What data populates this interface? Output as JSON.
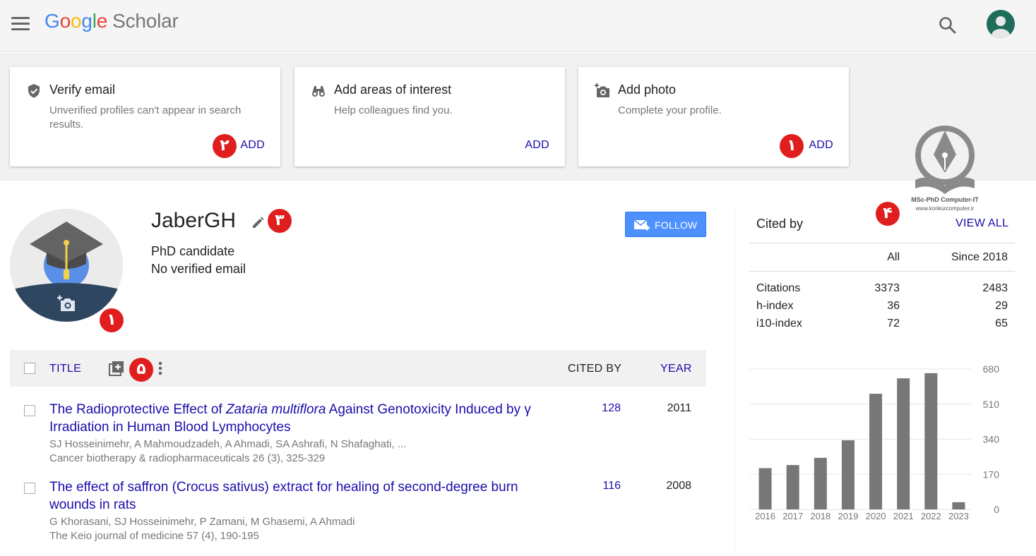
{
  "header": {
    "logo_google": [
      "G",
      "o",
      "o",
      "g",
      "l",
      "e"
    ],
    "logo_scholar": "Scholar"
  },
  "cards": [
    {
      "title": "Verify email",
      "desc": "Unverified profiles can't appear in search results.",
      "action": "ADD",
      "icon": "verified-shield-icon"
    },
    {
      "title": "Add areas of interest",
      "desc": "Help colleagues find you.",
      "action": "ADD",
      "icon": "binoculars-icon"
    },
    {
      "title": "Add photo",
      "desc": "Complete your profile.",
      "action": "ADD",
      "icon": "add-photo-icon"
    }
  ],
  "watermark": {
    "line1": "MSc-PhD Computer-IT",
    "line2": "www.konkurcomputer.ir"
  },
  "badges": {
    "card1": "۲",
    "card3": "۱",
    "name": "۳",
    "cited": "۴",
    "photo": "۱",
    "table": "۵"
  },
  "profile": {
    "name": "JaberGH",
    "line1": "PhD candidate",
    "line2": "No verified email",
    "follow_label": "FOLLOW"
  },
  "table": {
    "title_header": "TITLE",
    "cited_header": "CITED BY",
    "year_header": "YEAR",
    "rows": [
      {
        "title_before": "The Radioprotective Effect of ",
        "title_italic": "Zataria multiflora",
        "title_after": " Against Genotoxicity Induced by γ Irradiation in Human Blood Lymphocytes",
        "authors": "SJ Hosseinimehr, A Mahmoudzadeh, A Ahmadi, SA Ashrafi, N Shafaghati, ...",
        "venue": "Cancer biotherapy & radiopharmaceuticals 26 (3), 325-329",
        "cited": "128",
        "year": "2011"
      },
      {
        "title": "The effect of saffron (Crocus sativus) extract for healing of second-degree burn wounds in rats",
        "authors": "G Khorasani, SJ Hosseinimehr, P Zamani, M Ghasemi, A Ahmadi",
        "venue": "The Keio journal of medicine 57 (4), 190-195",
        "cited": "116",
        "year": "2008"
      }
    ]
  },
  "cited_by": {
    "title": "Cited by",
    "view_all": "VIEW ALL",
    "col_all": "All",
    "col_since": "Since 2018",
    "metrics": [
      {
        "label": "Citations",
        "all": "3373",
        "since": "2483"
      },
      {
        "label": "h-index",
        "all": "36",
        "since": "29"
      },
      {
        "label": "i10-index",
        "all": "72",
        "since": "65"
      }
    ]
  },
  "chart_data": {
    "type": "bar",
    "categories": [
      "2016",
      "2017",
      "2018",
      "2019",
      "2020",
      "2021",
      "2022",
      "2023"
    ],
    "values": [
      200,
      215,
      250,
      335,
      560,
      635,
      660,
      35
    ],
    "ylim": [
      0,
      680
    ],
    "yticks": [
      0,
      170,
      340,
      510,
      680
    ],
    "bar_color": "#777777",
    "grid": true
  },
  "colors": {
    "link": "#1a0dab",
    "badge": "#e01e1e",
    "follow": "#4d90fe"
  }
}
